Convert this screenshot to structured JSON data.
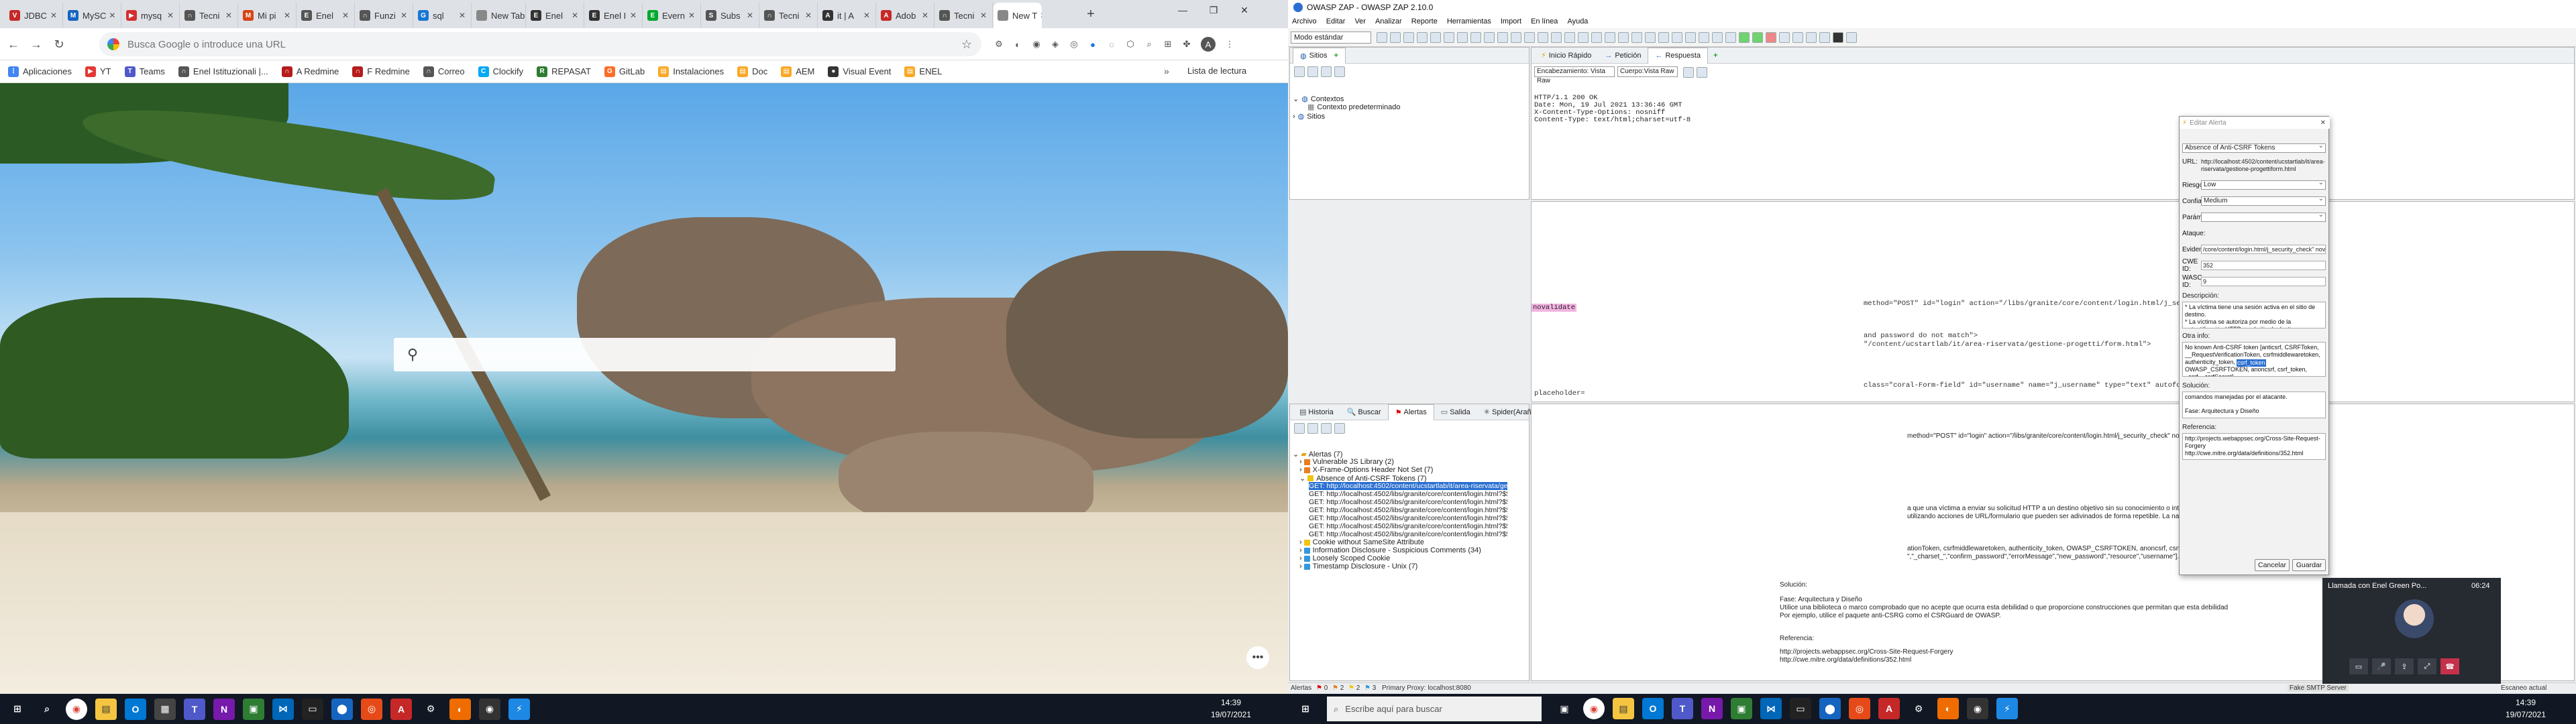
{
  "chrome": {
    "tabs": [
      {
        "label": "JDBC",
        "color": "#c62828",
        "glyph": "V"
      },
      {
        "label": "MySC",
        "color": "#1565c0",
        "glyph": "M"
      },
      {
        "label": "mysq",
        "color": "#d32f2f",
        "glyph": "▶"
      },
      {
        "label": "Tecni",
        "color": "#555555",
        "glyph": "∩"
      },
      {
        "label": "Mi pi",
        "color": "#d84315",
        "glyph": "M"
      },
      {
        "label": "Enel",
        "color": "#555555",
        "glyph": "E"
      },
      {
        "label": "Funzi",
        "color": "#555555",
        "glyph": "∩"
      },
      {
        "label": "sql",
        "color": "#1976d2",
        "glyph": "G"
      },
      {
        "label": "New Tab",
        "color": "#888888",
        "glyph": ""
      },
      {
        "label": "Enel",
        "color": "#333333",
        "glyph": "E"
      },
      {
        "label": "Enel I",
        "color": "#333333",
        "glyph": "E"
      },
      {
        "label": "Evern",
        "color": "#00a82d",
        "glyph": "E"
      },
      {
        "label": "Subs",
        "color": "#555555",
        "glyph": "S"
      },
      {
        "label": "Tecni",
        "color": "#555555",
        "glyph": "∩"
      },
      {
        "label": "it | A",
        "color": "#333333",
        "glyph": "A"
      },
      {
        "label": "Adob",
        "color": "#c62828",
        "glyph": "A"
      },
      {
        "label": "Tecni",
        "color": "#555555",
        "glyph": "∩"
      },
      {
        "label": "New T",
        "color": "#888888",
        "glyph": ""
      }
    ],
    "omnibox_placeholder": "Busca Google o introduce una URL",
    "bookmarks": [
      {
        "label": "Aplicaciones",
        "color": "#4285f4",
        "glyph": "⋮"
      },
      {
        "label": "YT",
        "color": "#e53935",
        "glyph": "▶"
      },
      {
        "label": "Teams",
        "color": "#5059c9",
        "glyph": "T"
      },
      {
        "label": "Enel Istituzionali |...",
        "color": "#555555",
        "glyph": "∩"
      },
      {
        "label": "A Redmine",
        "color": "#b71c1c",
        "glyph": "∩"
      },
      {
        "label": "F Redmine",
        "color": "#b71c1c",
        "glyph": "∩"
      },
      {
        "label": "Correo",
        "color": "#555555",
        "glyph": "∩"
      },
      {
        "label": "Clockify",
        "color": "#03a9f4",
        "glyph": "C"
      },
      {
        "label": "REPASAT",
        "color": "#2e7d32",
        "glyph": "R"
      },
      {
        "label": "GitLab",
        "color": "#fc6d26",
        "glyph": "G"
      },
      {
        "label": "Instalaciones",
        "color": "#f9a825",
        "glyph": "▤"
      },
      {
        "label": "Doc",
        "color": "#f9a825",
        "glyph": "▤"
      },
      {
        "label": "AEM",
        "color": "#f9a825",
        "glyph": "▤"
      },
      {
        "label": "Visual Event",
        "color": "#333333",
        "glyph": "●"
      },
      {
        "label": "ENEL",
        "color": "#f9a825",
        "glyph": "▤"
      }
    ],
    "bookmarks_more": "»",
    "reading_list": "Lista de lectura",
    "search_placeholder": ""
  },
  "taskbar_left": {
    "time": "14:39",
    "date": "19/07/2021"
  },
  "taskbar_right": {
    "search_placeholder": "Escribe aquí para buscar",
    "time": "14:39",
    "date": "19/07/2021"
  },
  "zap": {
    "title": "OWASP ZAP - OWASP ZAP 2.10.0",
    "menu": [
      "Archivo",
      "Editar",
      "Ver",
      "Analizar",
      "Reporte",
      "Herramientas",
      "Import",
      "En línea",
      "Ayuda"
    ],
    "mode": "Modo estándar",
    "sites_tab": "Sitios",
    "contexts": "Contextos",
    "default_context": "Contexto predeterminado",
    "sites": "Sitios",
    "top_tabs": [
      {
        "label": "Inicio Rápido",
        "icon": "⚡"
      },
      {
        "label": "Petición",
        "icon": "→"
      },
      {
        "label": "Respuesta",
        "icon": "←"
      }
    ],
    "header_select": "Encabezamiento: Vista Raw",
    "body_select": "Cuerpo:Vista Raw",
    "response_lines": [
      "HTTP/1.1 200 OK",
      "Date: Mon, 19 Jul 2021 13:36:46 GMT",
      "X-Content-Type-Options: nosniff",
      "Content-Type: text/html;charset=utf-8"
    ],
    "body_fragments": [
      "method=\"POST\" id=\"login\" action=\"/libs/granite/core/content/login.html/j_security_check\" novalidate=",
      "and password do not match\">",
      "\"/content/ucstartlab/it/area-riservata/gestione-progetti/form.html\">",
      "class=\"coral-Form-field\" id=\"username\" name=\"j_username\" type=\"text\" autofocus=\"autofocus\" pattern=\".*\""
    ],
    "novalidate_tag": "novalidate",
    "placeholder_frag": "placeholder=",
    "bottom_tabs": [
      {
        "label": "Historia",
        "icon": "▤"
      },
      {
        "label": "Buscar",
        "icon": "🔍"
      },
      {
        "label": "Alertas",
        "icon": "⚑"
      },
      {
        "label": "Salida",
        "icon": "▭"
      },
      {
        "label": "Spider(Araña)",
        "icon": "✳"
      },
      {
        "label": "Escaneo Activo",
        "icon": "◉"
      }
    ],
    "alerts_root": "Alertas (7)",
    "alert_groups": [
      {
        "label": "Vulnerable JS Library (2)",
        "color": "#e67e22"
      },
      {
        "label": "X-Frame-Options Header Not Set (7)",
        "color": "#e67e22"
      },
      {
        "label": "Absence of Anti-CSRF Tokens (7)",
        "color": "#f1c40f"
      }
    ],
    "alert_requests": [
      "GET: http://localhost:4502/content/ucstartlab/it/area-riservata/gestione-progetti/form.html",
      "GET: http://localhost:4502/libs/granite/core/content/login.html?$$login$$=%24%24login%24%24&j_reason=invalid_logi",
      "GET: http://localhost:4502/libs/granite/core/content/login.html?$$login$$=%24%24login%24%24&j_reason=invalid_logi",
      "GET: http://localhost:4502/libs/granite/core/content/login.html?$$login$$=%24%24login%24%24&j_reason=unknown&j",
      "GET: http://localhost:4502/libs/granite/core/content/login.html?$$login$$=%24%24login%24%24&j_reason=invalid_logi",
      "GET: http://localhost:4502/libs/granite/core/content/login.html?$$login$$=%24%24login%24%24&j_reason=unknown&j",
      "GET: http://localhost:4502/libs/granite/core/content/login.html?$$login$$=%24%24login%24%24&j_reason=unknown&j"
    ],
    "alert_groups_after": [
      {
        "label": "Cookie without SameSite Attribute",
        "color": "#f1c40f"
      },
      {
        "label": "Information Disclosure - Suspicious Comments (34)",
        "color": "#3498db"
      },
      {
        "label": "Loosely Scoped Cookie",
        "color": "#3498db"
      },
      {
        "label": "Timestamp Disclosure - Unix (7)",
        "color": "#3498db"
      }
    ],
    "detail_form_line": "method=\"POST\" id=\"login\" action=\"/libs/granite/core/content/login.html/j_security_check\" novalidate=\"novalidate\">",
    "detail_desc": [
      "a que una víctima a enviar su solicitud HTTP a un destino objetivo sin su conocimiento o intención para poder realizar una acción",
      "utilizando acciones de URL/formulario que pueden ser adivinados de forma repetible. La naturaleza del ataque es que CSRF"
    ],
    "detail_other": [
      "ationToken, csrfmiddlewaretoken, authenticity_token, OWASP_CSRFTOKEN, anoncsrf, csrf_token, _csrf, _csrfSecret.",
      "\",\"_charset_\",\"confirm_password\",\"errorMessage\",\"new_password\",\"resource\",\"username\"]."
    ],
    "detail_solution_label": "Solución:",
    "detail_solution": [
      "Fase: Arquitectura y Diseño",
      "Utilice una biblioteca o marco comprobado que no acepte que ocurra esta debilidad o que proporcione construcciones que permitan que esta debilidad",
      "Por ejemplo, utilice el paquete anti-CSRG como el CSRGuard de OWASP."
    ],
    "detail_ref_label": "Referencia:",
    "detail_refs": [
      "http://projects.webappsec.org/Cross-Site-Request-Forgery",
      "http://cwe.mitre.org/data/definitions/352.html"
    ],
    "status": {
      "alerts": "Alertas",
      "counts": [
        "0",
        "2",
        "2",
        "3"
      ],
      "proxy": "Primary Proxy: localhost:8080",
      "smtp": "Fake SMTP Server",
      "active": "Escaneo actual"
    }
  },
  "dialog": {
    "title": "Editar Alerta",
    "alert_name": "Absence of Anti-CSRF Tokens",
    "url_label": "URL:",
    "url": "http://localhost:4502/content/ucstartlab/it/area-riservata/gestione-progettiform.html",
    "risk_label": "Riesgo:",
    "risk": "Low",
    "confidence_label": "Confianza:",
    "confidence": "Medium",
    "param_label": "Parámetro:",
    "param": "",
    "attack_label": "Ataque:",
    "evidence_label": "Evidencia:",
    "evidence": "/core/content/login.html/j_security_check\" novalidate=\"novalidate\">",
    "cwe_label": "CWE ID:",
    "cwe": "352",
    "wasc_label": "WASC ID:",
    "wasc": "9",
    "desc_label": "Descripción:",
    "description": [
      "* La víctima tiene una sesión activa en el sitio de destino.",
      "* La víctima se autoriza por medio de la autentificación HTTP en el sitio de destino."
    ],
    "other_label": "Otra info:",
    "other": [
      "No known Anti-CSRF token [anticsrf, CSRFToken,",
      "__RequestVerificationToken, csrfmiddlewaretoken, authenticity_token,",
      "OWASP_CSRFTOKEN, anoncsrf, csrf_token, _csrf, _csrfSecret]."
    ],
    "other_highlight": "csrf_token",
    "solution_label": "Solución:",
    "solution_top": "comandos manejadas por el atacante.",
    "solution_phase": "Fase: Arquitectura y Diseño",
    "ref_label": "Referencia:",
    "refs": [
      "http://projects.webappsec.org/Cross-Site-Request-Forgery",
      "http://cwe.mitre.org/data/definitions/352.html"
    ],
    "cancel": "Cancelar",
    "save": "Guardar"
  },
  "call": {
    "title": "Llamada con Enel Green Po...",
    "time": "06:24"
  }
}
